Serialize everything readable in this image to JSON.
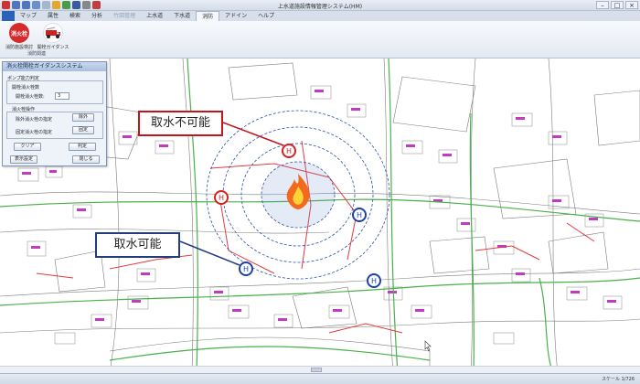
{
  "window": {
    "title": "上水道施設情報管理システム(HM)",
    "minimize": "–",
    "maximize": "□",
    "close": "×"
  },
  "ribbon": {
    "tabs": [
      {
        "label": "マップ",
        "state": "normal"
      },
      {
        "label": "属性",
        "state": "normal"
      },
      {
        "label": "検索",
        "state": "normal"
      },
      {
        "label": "分析",
        "state": "normal"
      },
      {
        "label": "竹図管理",
        "state": "disabled"
      },
      {
        "label": "上水道",
        "state": "normal"
      },
      {
        "label": "下水道",
        "state": "normal"
      },
      {
        "label": "消防",
        "state": "active"
      },
      {
        "label": "アドイン",
        "state": "normal"
      },
      {
        "label": "ヘルプ",
        "state": "normal"
      }
    ],
    "buttons": [
      {
        "label": "消防施設検討",
        "icon_text": "消火栓",
        "color": "#d62b2b"
      },
      {
        "label": "開栓ガイダンス",
        "icon_text": "",
        "color": "#cc2222"
      }
    ],
    "group_label": "消防関連"
  },
  "dialog": {
    "title": "消火栓開栓ガイダンスシステム",
    "section_pump": "ポンプ能力判定",
    "subsection_open_count": "開栓消火栓数",
    "open_count_label": "開栓消火栓数:",
    "open_count_value": "3",
    "section_operation": "消火栓操作",
    "target_exclude_label": "除外消火栓の指定",
    "target_exclude_button": "除外",
    "fixed_label": "固定消火栓の指定",
    "fixed_button": "固定",
    "clear_button": "クリア",
    "judge_button": "判定",
    "display_settings_button": "表示設定",
    "close_button": "閉じる"
  },
  "callouts": {
    "not_available": "取水不可能",
    "available": "取水可能"
  },
  "status": {
    "scale": "スケール 1/726"
  },
  "colors": {
    "hydrant_unavailable": "#d42020",
    "hydrant_available": "#1f3fa8",
    "pipe_green": "#4ab04a",
    "pipe_red": "#e23c3c",
    "fire": "#f26b1d"
  },
  "icons": {
    "fire": "fire-icon",
    "hydrant": "hydrant-icon",
    "ribbon_hydrant": "hydrant-emblem-icon",
    "ribbon_truck": "fire-truck-icon"
  }
}
